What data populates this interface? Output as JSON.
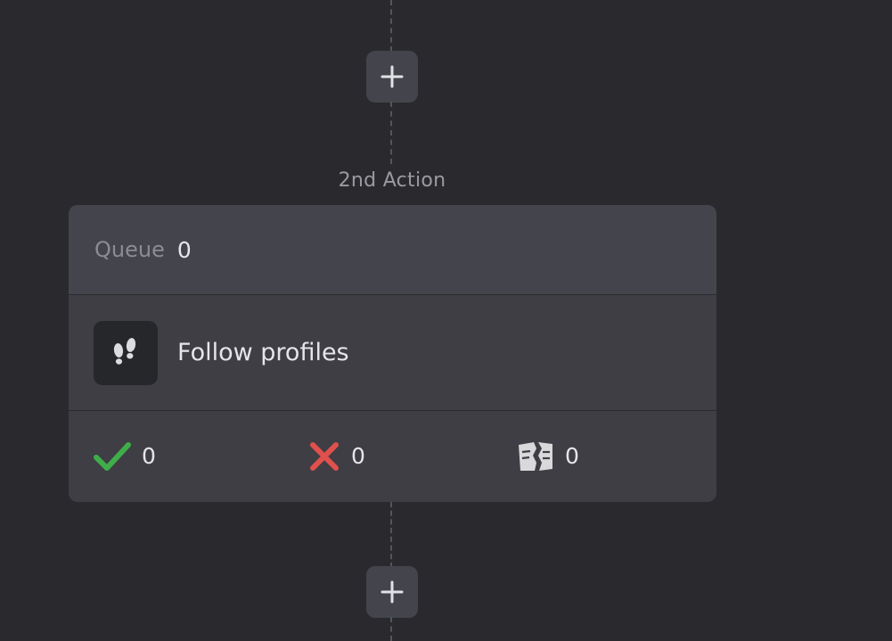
{
  "flow": {
    "step_label": "2nd Action"
  },
  "card": {
    "queue": {
      "label": "Queue",
      "count": "0"
    },
    "action": {
      "icon": "footprints-icon",
      "title": "Follow profiles"
    },
    "stats": {
      "success": {
        "icon": "checkmark-icon",
        "value": "0",
        "color": "#3fae4a"
      },
      "failed": {
        "icon": "cross-icon",
        "value": "0",
        "color": "#e0504d"
      },
      "skipped": {
        "icon": "torn-page-icon",
        "value": "0",
        "color": "#d9d9dc"
      }
    }
  },
  "colors": {
    "background": "#2a2a2e",
    "card": "#3e3e44",
    "button": "#44454c"
  }
}
